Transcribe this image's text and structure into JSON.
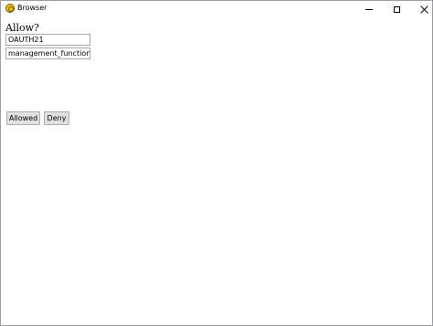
{
  "window": {
    "title": "Browser"
  },
  "page": {
    "prompt": "Allow?",
    "fields": [
      {
        "value": "OAUTH21"
      },
      {
        "value": "management_functions"
      }
    ],
    "buttons": {
      "allow_label": "Allowed",
      "deny_label": "Deny"
    }
  },
  "icons": {
    "app": "browser-app-icon",
    "minimize": "minimize-icon",
    "maximize": "maximize-icon",
    "close": "close-icon"
  },
  "colors": {
    "app_icon": "#f2c200",
    "button_bg": "#e1e1e1",
    "button_border": "#adadad"
  }
}
